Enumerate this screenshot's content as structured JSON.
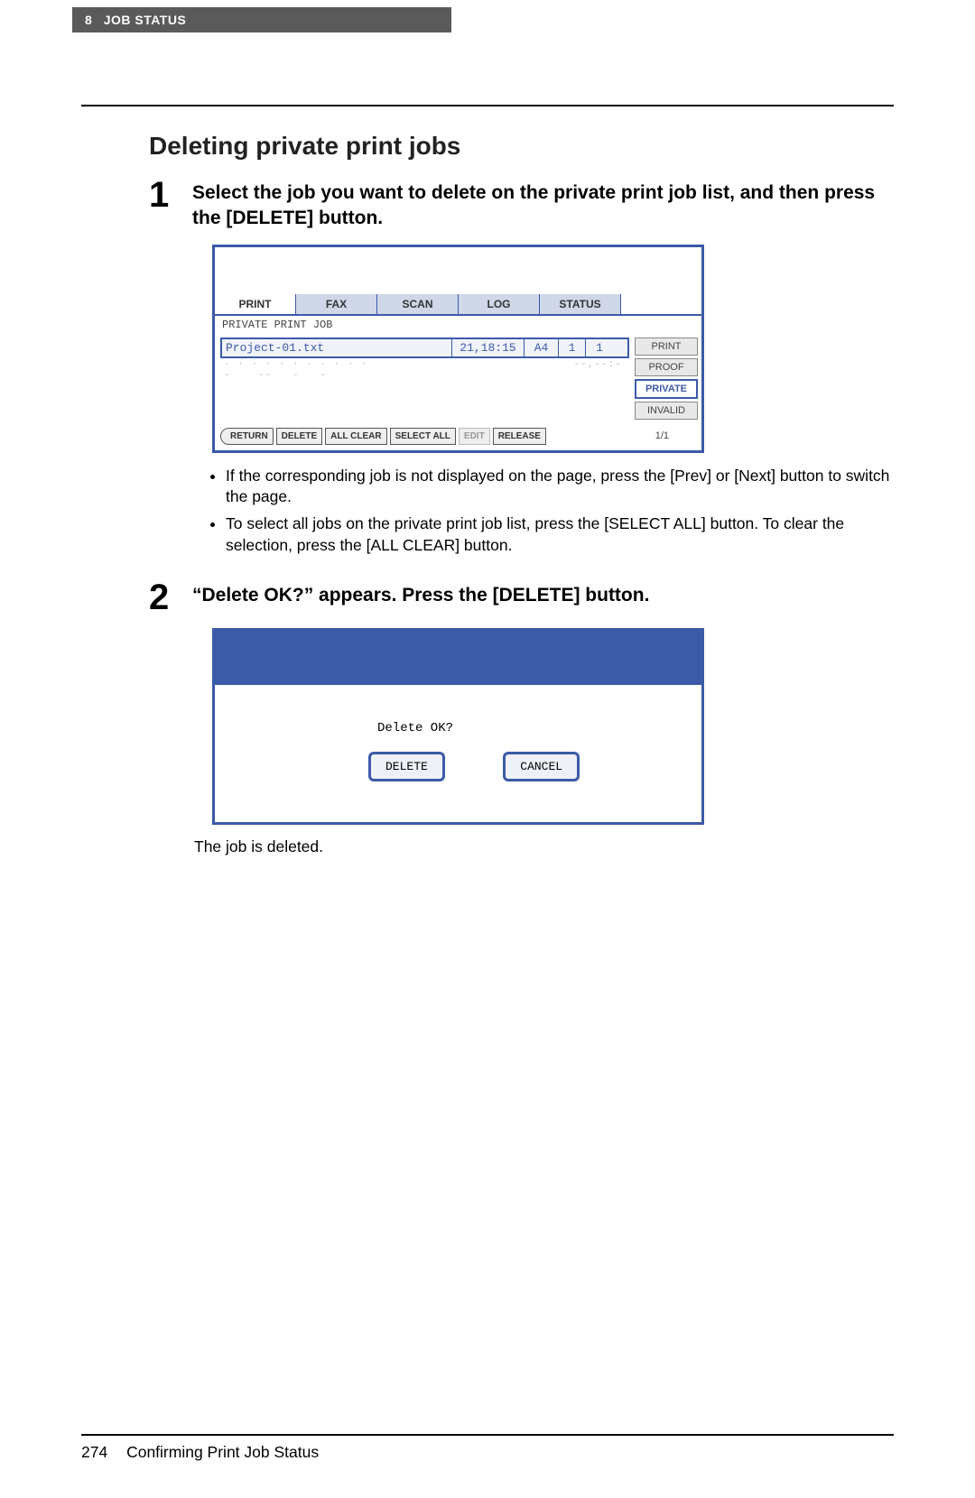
{
  "header": {
    "chapter_num": "8",
    "chapter_title": "JOB STATUS"
  },
  "section_title": "Deleting private print jobs",
  "steps": {
    "s1": {
      "num": "1",
      "text": "Select the job you want to delete on the private print job list, and then press the [DELETE] button."
    },
    "s2": {
      "num": "2",
      "text": "“Delete OK?” appears. Press the [DELETE] button."
    }
  },
  "panel": {
    "tabs": {
      "print": "PRINT",
      "fax": "FAX",
      "scan": "SCAN",
      "log": "LOG",
      "status": "STATUS"
    },
    "sublabel": "PRIVATE PRINT JOB",
    "job": {
      "name": "Project-01.txt",
      "time": "21,18:15",
      "paper": "A4",
      "c1": "1",
      "c2": "1"
    },
    "cats": {
      "print": "PRINT",
      "proof": "PROOF",
      "private": "PRIVATE",
      "invalid": "INVALID"
    },
    "btns": {
      "return": "RETURN",
      "delete": "DELETE",
      "allclear": "ALL CLEAR",
      "selectall": "SELECT ALL",
      "edit": "EDIT",
      "release": "RELEASE"
    },
    "pageind": "1/1"
  },
  "notes": {
    "n1": "If the corresponding job is not displayed on the page, press the [Prev] or [Next] button to switch the page.",
    "n2": "To select all jobs on the private print job list, press the [SELECT ALL] button. To clear the selection, press the [ALL CLEAR] button."
  },
  "dialog": {
    "msg": "Delete OK?",
    "delete": "DELETE",
    "cancel": "CANCEL"
  },
  "result_text": "The job is deleted.",
  "footer": {
    "page_num": "274",
    "title": "Confirming Print Job Status"
  }
}
